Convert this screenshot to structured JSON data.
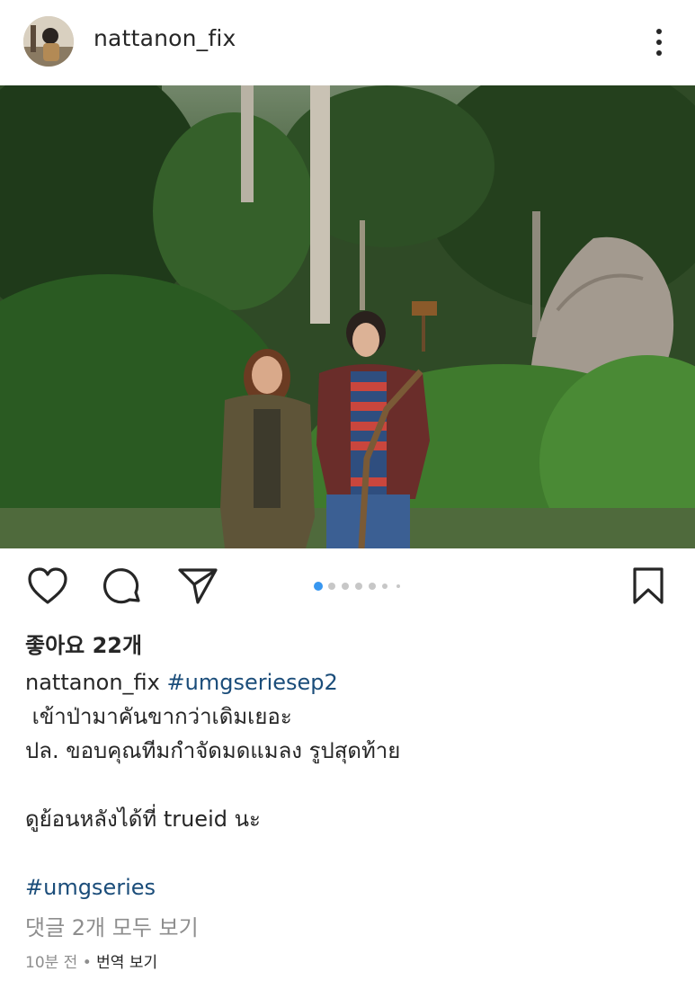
{
  "post": {
    "username": "nattanon_fix",
    "likes_text": "좋아요 22개",
    "caption_user": "nattanon_fix",
    "caption_hashtag": "#umgseriesep2",
    "caption_lines": [
      " เข้าป่ามาคันขากว่าเดิมเยอะ",
      "ปล. ขอบคุณทีมกำจัดมดแมลง รูปสุดท้าย",
      "",
      "ดูย้อนหลังได้ที่ trueid นะ",
      ""
    ],
    "hashtag_line": "#umgseries",
    "view_comments": "댓글 2개 모두 보기",
    "time_ago": "10분 전",
    "separator": " • ",
    "translate": "번역 보기",
    "carousel": {
      "count": 7,
      "active_index": 0
    }
  },
  "icons": {
    "more": "more-vertical-icon",
    "like": "heart-icon",
    "comment": "comment-icon",
    "share": "send-icon",
    "save": "bookmark-icon"
  },
  "colors": {
    "hashtag": "#1b4d7a",
    "carousel_active": "#3897f0",
    "muted": "#8e8e8e",
    "text": "#262626"
  }
}
